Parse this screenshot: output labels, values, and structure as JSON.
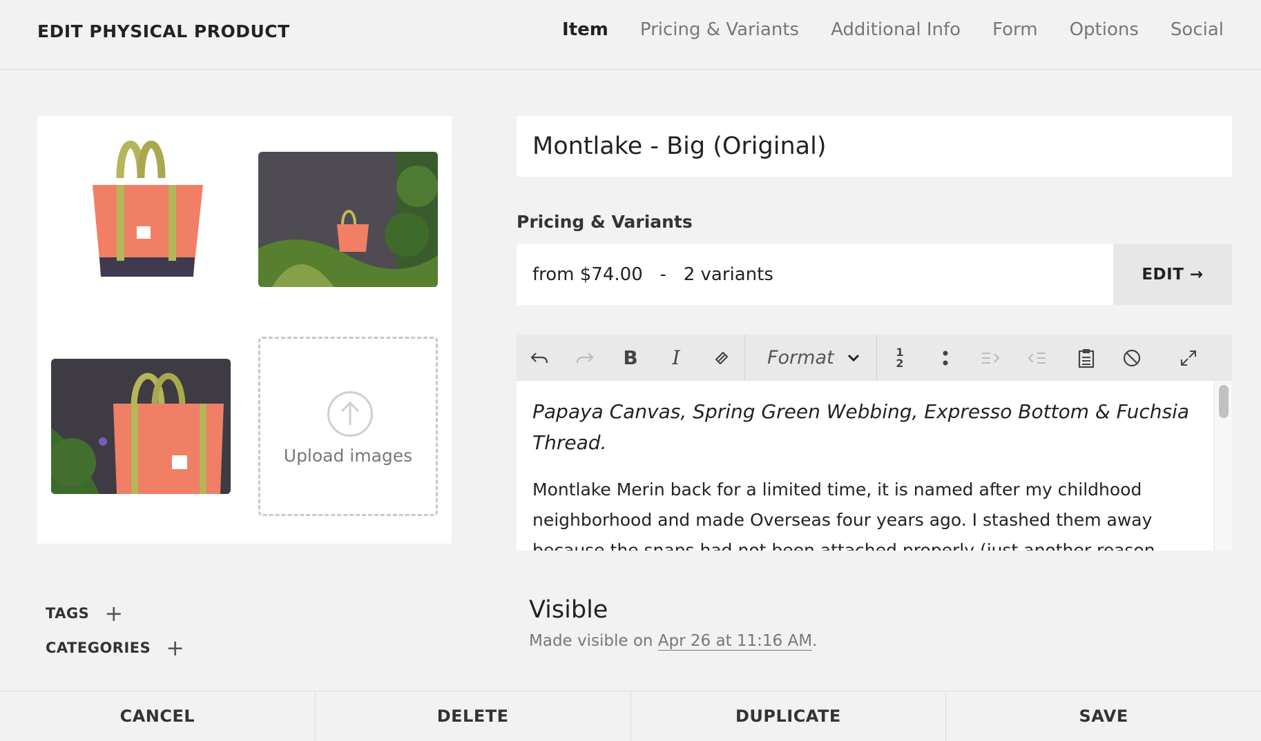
{
  "header": {
    "title": "EDIT PHYSICAL PRODUCT",
    "tabs": [
      {
        "label": "Item",
        "active": true
      },
      {
        "label": "Pricing & Variants"
      },
      {
        "label": "Additional Info"
      },
      {
        "label": "Form"
      },
      {
        "label": "Options"
      },
      {
        "label": "Social"
      }
    ]
  },
  "images": {
    "upload_label": "Upload images",
    "items": [
      "tote-bag-product-photo",
      "tote-bag-in-garden-photo",
      "tote-bag-closeup-photo"
    ]
  },
  "product": {
    "title": "Montlake - Big (Original)"
  },
  "pricing": {
    "section_label": "Pricing & Variants",
    "summary": "from $74.00   -   2 variants",
    "edit_label": "EDIT →"
  },
  "editor": {
    "format_label": "Format",
    "toolbar_icons": [
      "undo-icon",
      "redo-icon",
      "bold-icon",
      "italic-icon",
      "link-icon",
      "format-dropdown",
      "numbered-list-icon",
      "bulleted-list-icon",
      "indent-icon",
      "outdent-icon",
      "paste-icon",
      "clear-format-icon",
      "expand-icon"
    ],
    "intro_italic": "Papaya Canvas, Spring Green Webbing, Expresso Bottom & Fuchsia Thread.",
    "body": "Montlake Merin back for a limited time, it is named after my childhood neighborhood and made Overseas four years ago. I stashed them away because the snaps had not been attached properly (just another reason"
  },
  "meta": {
    "tags_label": "TAGS",
    "categories_label": "CATEGORIES"
  },
  "visibility": {
    "title": "Visible",
    "prefix": "Made visible on ",
    "date_link": "Apr 26 at 11:16 AM",
    "suffix": "."
  },
  "footer": {
    "cancel": "CANCEL",
    "delete": "DELETE",
    "duplicate": "DUPLICATE",
    "save": "SAVE"
  },
  "colors": {
    "background": "#f2f2f2",
    "bag_body": "#f07f66",
    "bag_straps": "#b5b55a",
    "bag_bottom": "#3f3a4f"
  }
}
